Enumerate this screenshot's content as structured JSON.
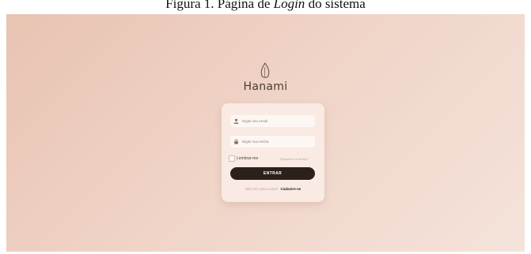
{
  "caption": {
    "prefix": "Figura 1. Página de ",
    "emphasis": "Login",
    "suffix": " do sistema"
  },
  "brand": {
    "name": "Hanami",
    "logo_icon": "leaf-outline-icon"
  },
  "login_form": {
    "email": {
      "placeholder": "Digite seu email",
      "icon": "user-icon"
    },
    "password": {
      "placeholder": "Digite sua senha",
      "icon": "lock-icon"
    },
    "remember_label": "Lembrar-me",
    "remember_checked": false,
    "forgot_label": "Esqueceu a senha?",
    "submit_label": "ENTRAR",
    "signup_question": "Não tem uma conta?",
    "signup_label": "Cadastre-se"
  },
  "colors": {
    "background_start": "#e8c3b2",
    "background_end": "#f5e3db",
    "card": "#faece5",
    "primary_button": "#2c201b",
    "muted_text": "#b7a59d"
  }
}
